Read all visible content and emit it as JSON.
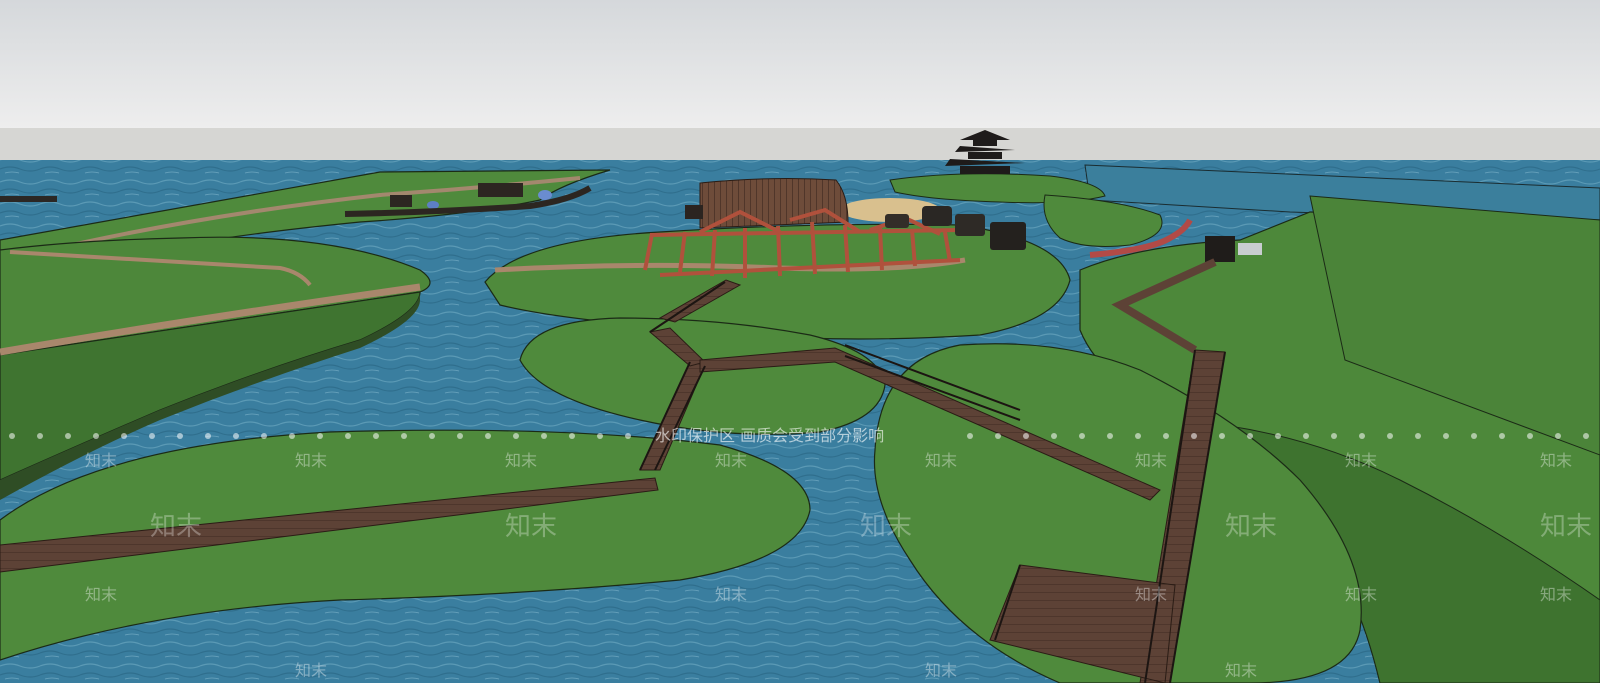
{
  "watermark": {
    "notice": "水印保护区 画质会受到部分影响",
    "mark": "知末"
  },
  "colors": {
    "sky_top": "#d5d8db",
    "sky_bottom": "#ededed",
    "horizon": "#d8d8d6",
    "grass": "#4f8a3c",
    "grass_dark": "#3c6e2e",
    "water": "#3b7fa0",
    "boardwalk": "#5b4034",
    "path": "#a9876c",
    "roof": "#6a4a38",
    "frame": "#b0523d"
  }
}
